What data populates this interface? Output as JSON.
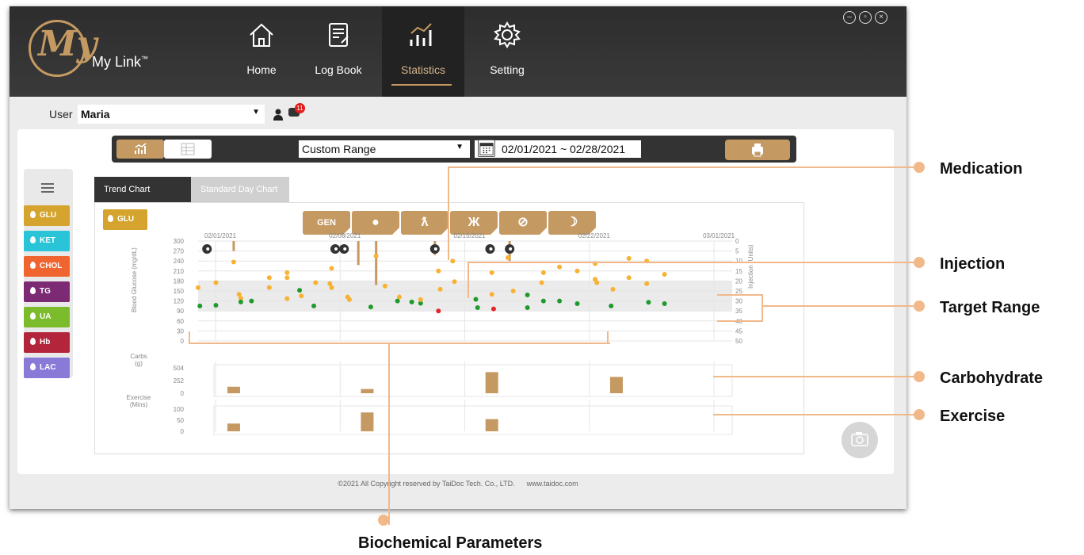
{
  "app": {
    "name": "My Link",
    "trademark": "™"
  },
  "nav": [
    {
      "label": "Home",
      "icon": "home-icon"
    },
    {
      "label": "Log Book",
      "icon": "logbook-icon"
    },
    {
      "label": "Statistics",
      "icon": "statistics-icon",
      "active": true
    },
    {
      "label": "Setting",
      "icon": "gear-icon"
    }
  ],
  "window_controls": [
    "minimize-icon",
    "restore-icon",
    "close-icon"
  ],
  "user": {
    "label": "User",
    "name": "Maria",
    "notification_count": "11"
  },
  "toolbar": {
    "range_label": "Custom Range",
    "date_range": "02/01/2021 ~ 02/28/2021"
  },
  "sidebar": {
    "params": [
      {
        "label": "GLU",
        "color": "#d4a42e"
      },
      {
        "label": "KET",
        "color": "#29c4d8"
      },
      {
        "label": "CHOL",
        "color": "#f0652f"
      },
      {
        "label": "TG",
        "color": "#7b2a73"
      },
      {
        "label": "UA",
        "color": "#7cbb2c"
      },
      {
        "label": "Hb",
        "color": "#b2253a"
      },
      {
        "label": "LAC",
        "color": "#8a7ad8"
      }
    ]
  },
  "tabs": [
    {
      "label": "Trend Chart",
      "active": true
    },
    {
      "label": "Standard Day Chart",
      "active": false
    }
  ],
  "chart": {
    "selected_param": "GLU",
    "filters": [
      "GEN",
      "apple-icon",
      "exercise-icon",
      "weightlift-icon",
      "no-meal-icon",
      "moon-icon"
    ],
    "date_labels": [
      "02/01/2021",
      "02/08/2021",
      "02/15/2021",
      "02/22/2021",
      "03/01/2021"
    ]
  },
  "chart_data": {
    "type": "scatter",
    "ylabel": "Blood Glucose (mg/dL)",
    "y2label": "Injection (Units)",
    "yticks": [
      300,
      270,
      240,
      210,
      180,
      150,
      120,
      90,
      60,
      30,
      0
    ],
    "y2ticks": [
      0,
      5,
      10,
      15,
      20,
      25,
      30,
      35,
      40,
      45,
      50
    ],
    "ylim": [
      0,
      300
    ],
    "y2lim": [
      0,
      50
    ],
    "target_range": [
      90,
      180
    ],
    "x_days": 31,
    "glucose_points": [
      {
        "day": 1.0,
        "value": 160,
        "color": "#f7b233"
      },
      {
        "day": 1.1,
        "value": 105,
        "color": "#1f9a2c"
      },
      {
        "day": 2.0,
        "value": 175,
        "color": "#f7b233"
      },
      {
        "day": 2.0,
        "value": 107,
        "color": "#1f9a2c"
      },
      {
        "day": 3.0,
        "value": 237,
        "color": "#f7b233"
      },
      {
        "day": 3.3,
        "value": 140,
        "color": "#f7b233"
      },
      {
        "day": 3.4,
        "value": 128,
        "color": "#f7b233"
      },
      {
        "day": 3.4,
        "value": 117,
        "color": "#1f9a2c"
      },
      {
        "day": 4.0,
        "value": 120,
        "color": "#1f9a2c"
      },
      {
        "day": 5.0,
        "value": 190,
        "color": "#f7b233"
      },
      {
        "day": 5.0,
        "value": 160,
        "color": "#f7b233"
      },
      {
        "day": 6.0,
        "value": 205,
        "color": "#f7b233"
      },
      {
        "day": 6.0,
        "value": 190,
        "color": "#f7b233"
      },
      {
        "day": 6.0,
        "value": 127,
        "color": "#f7b233"
      },
      {
        "day": 6.7,
        "value": 152,
        "color": "#1f9a2c"
      },
      {
        "day": 6.8,
        "value": 135,
        "color": "#f7b233"
      },
      {
        "day": 7.5,
        "value": 105,
        "color": "#1f9a2c"
      },
      {
        "day": 7.6,
        "value": 175,
        "color": "#f7b233"
      },
      {
        "day": 8.4,
        "value": 172,
        "color": "#f7b233"
      },
      {
        "day": 8.5,
        "value": 160,
        "color": "#f7b233"
      },
      {
        "day": 8.5,
        "value": 218,
        "color": "#f7b233"
      },
      {
        "day": 9.4,
        "value": 132,
        "color": "#f7b233"
      },
      {
        "day": 9.5,
        "value": 124,
        "color": "#f7b233"
      },
      {
        "day": 10.7,
        "value": 102,
        "color": "#1f9a2c"
      },
      {
        "day": 11.0,
        "value": 255,
        "color": "#f7b233"
      },
      {
        "day": 11.5,
        "value": 165,
        "color": "#f7b233"
      },
      {
        "day": 12.2,
        "value": 120,
        "color": "#1f9a2c"
      },
      {
        "day": 12.3,
        "value": 132,
        "color": "#f7b233"
      },
      {
        "day": 13.0,
        "value": 117,
        "color": "#1f9a2c"
      },
      {
        "day": 13.5,
        "value": 113,
        "color": "#1f9a2c"
      },
      {
        "day": 13.5,
        "value": 124,
        "color": "#f7b233"
      },
      {
        "day": 14.5,
        "value": 210,
        "color": "#f7b233"
      },
      {
        "day": 14.6,
        "value": 155,
        "color": "#f7b233"
      },
      {
        "day": 14.5,
        "value": 90,
        "color": "#e2272a"
      },
      {
        "day": 15.3,
        "value": 240,
        "color": "#f7b233"
      },
      {
        "day": 15.4,
        "value": 178,
        "color": "#f7b233"
      },
      {
        "day": 16.6,
        "value": 125,
        "color": "#1f9a2c"
      },
      {
        "day": 16.7,
        "value": 100,
        "color": "#1f9a2c"
      },
      {
        "day": 17.5,
        "value": 205,
        "color": "#f7b233"
      },
      {
        "day": 17.5,
        "value": 140,
        "color": "#f7b233"
      },
      {
        "day": 17.6,
        "value": 96,
        "color": "#e2272a"
      },
      {
        "day": 18.4,
        "value": 250,
        "color": "#f7b233"
      },
      {
        "day": 18.7,
        "value": 150,
        "color": "#f7b233"
      },
      {
        "day": 19.5,
        "value": 138,
        "color": "#1f9a2c"
      },
      {
        "day": 19.5,
        "value": 100,
        "color": "#1f9a2c"
      },
      {
        "day": 20.4,
        "value": 205,
        "color": "#f7b233"
      },
      {
        "day": 20.3,
        "value": 175,
        "color": "#f7b233"
      },
      {
        "day": 20.4,
        "value": 120,
        "color": "#1f9a2c"
      },
      {
        "day": 21.3,
        "value": 222,
        "color": "#f7b233"
      },
      {
        "day": 21.3,
        "value": 120,
        "color": "#1f9a2c"
      },
      {
        "day": 22.3,
        "value": 210,
        "color": "#f7b233"
      },
      {
        "day": 22.3,
        "value": 112,
        "color": "#1f9a2c"
      },
      {
        "day": 23.3,
        "value": 232,
        "color": "#f7b233"
      },
      {
        "day": 23.3,
        "value": 185,
        "color": "#f7b233"
      },
      {
        "day": 23.4,
        "value": 175,
        "color": "#f7b233"
      },
      {
        "day": 24.3,
        "value": 155,
        "color": "#f7b233"
      },
      {
        "day": 24.2,
        "value": 105,
        "color": "#1f9a2c"
      },
      {
        "day": 25.2,
        "value": 248,
        "color": "#f7b233"
      },
      {
        "day": 25.2,
        "value": 190,
        "color": "#f7b233"
      },
      {
        "day": 26.2,
        "value": 240,
        "color": "#f7b233"
      },
      {
        "day": 26.2,
        "value": 172,
        "color": "#f7b233"
      },
      {
        "day": 26.3,
        "value": 116,
        "color": "#1f9a2c"
      },
      {
        "day": 27.2,
        "value": 200,
        "color": "#f7b233"
      },
      {
        "day": 27.2,
        "value": 112,
        "color": "#1f9a2c"
      }
    ],
    "injections": [
      {
        "day": 3.0,
        "units": 5
      },
      {
        "day": 10.0,
        "units": 12
      },
      {
        "day": 11.0,
        "units": 22
      },
      {
        "day": 14.3,
        "units": 7
      },
      {
        "day": 18.5,
        "units": 10
      }
    ],
    "medications": [
      1.5,
      8.7,
      9.2,
      14.3,
      17.4,
      18.5
    ],
    "carbs": {
      "label": "Carbs (g)",
      "yticks": [
        504,
        252,
        0
      ],
      "ylim": [
        0,
        504
      ],
      "bars": [
        {
          "day": 3.0,
          "value": 130
        },
        {
          "day": 10.5,
          "value": 85
        },
        {
          "day": 17.5,
          "value": 420
        },
        {
          "day": 24.5,
          "value": 325
        }
      ]
    },
    "exercise": {
      "label": "Exercise (Mins)",
      "yticks": [
        100,
        50,
        0
      ],
      "ylim": [
        0,
        100
      ],
      "bars": [
        {
          "day": 3.0,
          "value": 35
        },
        {
          "day": 10.5,
          "value": 85
        },
        {
          "day": 17.5,
          "value": 55
        }
      ]
    }
  },
  "footer": {
    "copyright": "©2021 All Copyright reserved by TaiDoc Tech. Co., LTD.",
    "url": "www.taidoc.com"
  },
  "annotations": [
    {
      "label": "Medication"
    },
    {
      "label": "Injection"
    },
    {
      "label": "Target Range"
    },
    {
      "label": "Carbohydrate"
    },
    {
      "label": "Exercise"
    },
    {
      "label": "Biochemical Parameters"
    }
  ]
}
